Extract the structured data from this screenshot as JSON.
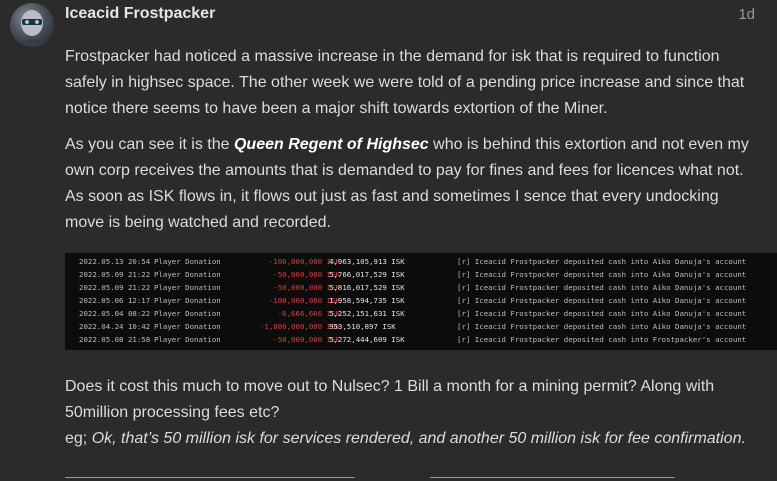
{
  "post": {
    "author": "Iceacid Frostpacker",
    "age": "1d",
    "paragraph1": "Frostpacker had noticed a massive increase in the demand for isk that is required to function safely in highsec space. The other week we were told of a pending price increase and since that notice there seems to have been a major shift towards extortion of the Miner.",
    "paragraph2_pre": "As you can see it is the ",
    "paragraph2_emph": "Queen Regent of Highsec",
    "paragraph2_post": " who is behind this extortion and not even my own corp receives the amounts that is demanded to pay for fines and fees for licences what not. As soon as ISK flows in, it flows out just as fast and sometimes I sence that every undocking move is being watched and recorded.",
    "question": "Does it cost this much to move out to Nulsec? 1 Bill a month for a mining permit? Along with 50million processing fees etc?",
    "quote_lead": "eg; ",
    "quote_text": "Ok, that’s 50 million isk for services rendered, and another 50 million isk for fee confirmation."
  },
  "ledger": [
    {
      "date": "2022.05.13  20:54",
      "type": "Player Donation",
      "amount": "-100,000,000  ISK",
      "balance": "4,963,105,913  ISK",
      "description": "[r] Iceacid Frostpacker deposited cash into Aiko Danuja's account"
    },
    {
      "date": "2022.05.09  21:22",
      "type": "Player Donation",
      "amount": "-50,000,000  ISK",
      "balance": "5,766,017,529  ISK",
      "description": "[r] Iceacid Frostpacker deposited cash into Aiko Danuja's account"
    },
    {
      "date": "2022.05.09  21:22",
      "type": "Player Donation",
      "amount": "-50,000,000  ISK",
      "balance": "5,816,017,529  ISK",
      "description": "[r] Iceacid Frostpacker deposited cash into Aiko Danuja's account"
    },
    {
      "date": "2022.05.06  12:17",
      "type": "Player Donation",
      "amount": "-100,000,000  ISK",
      "balance": "1,958,594,735  ISK",
      "description": "[r] Iceacid Frostpacker deposited cash into Aiko Danuja's account"
    },
    {
      "date": "2022.05.04  08:22",
      "type": "Player Donation",
      "amount": "-6,666,666  ISK",
      "balance": "5,252,151,631  ISK",
      "description": "[r] Iceacid Frostpacker deposited cash into Aiko Danuja's account"
    },
    {
      "date": "2022.04.24  10:42",
      "type": "Player Donation",
      "amount": "-1,000,000,000  ISK",
      "balance": "953,510,897  ISK",
      "description": "[r] Iceacid Frostpacker deposited cash into Aiko Danuja's account"
    },
    {
      "date": "2022.05.08  21:58",
      "type": "Player Donation",
      "amount": "-50,000,000  ISK",
      "balance": "5,272,444,609  ISK",
      "description": "[r] Iceacid Frostpacker deposited cash into Frostpacker's account"
    }
  ],
  "colors": {
    "background": "#2b2b2b",
    "negative_amount": "#d8403a",
    "ledger_bg": "#0c0c0c"
  },
  "icons": {
    "avatar": "user-avatar"
  }
}
